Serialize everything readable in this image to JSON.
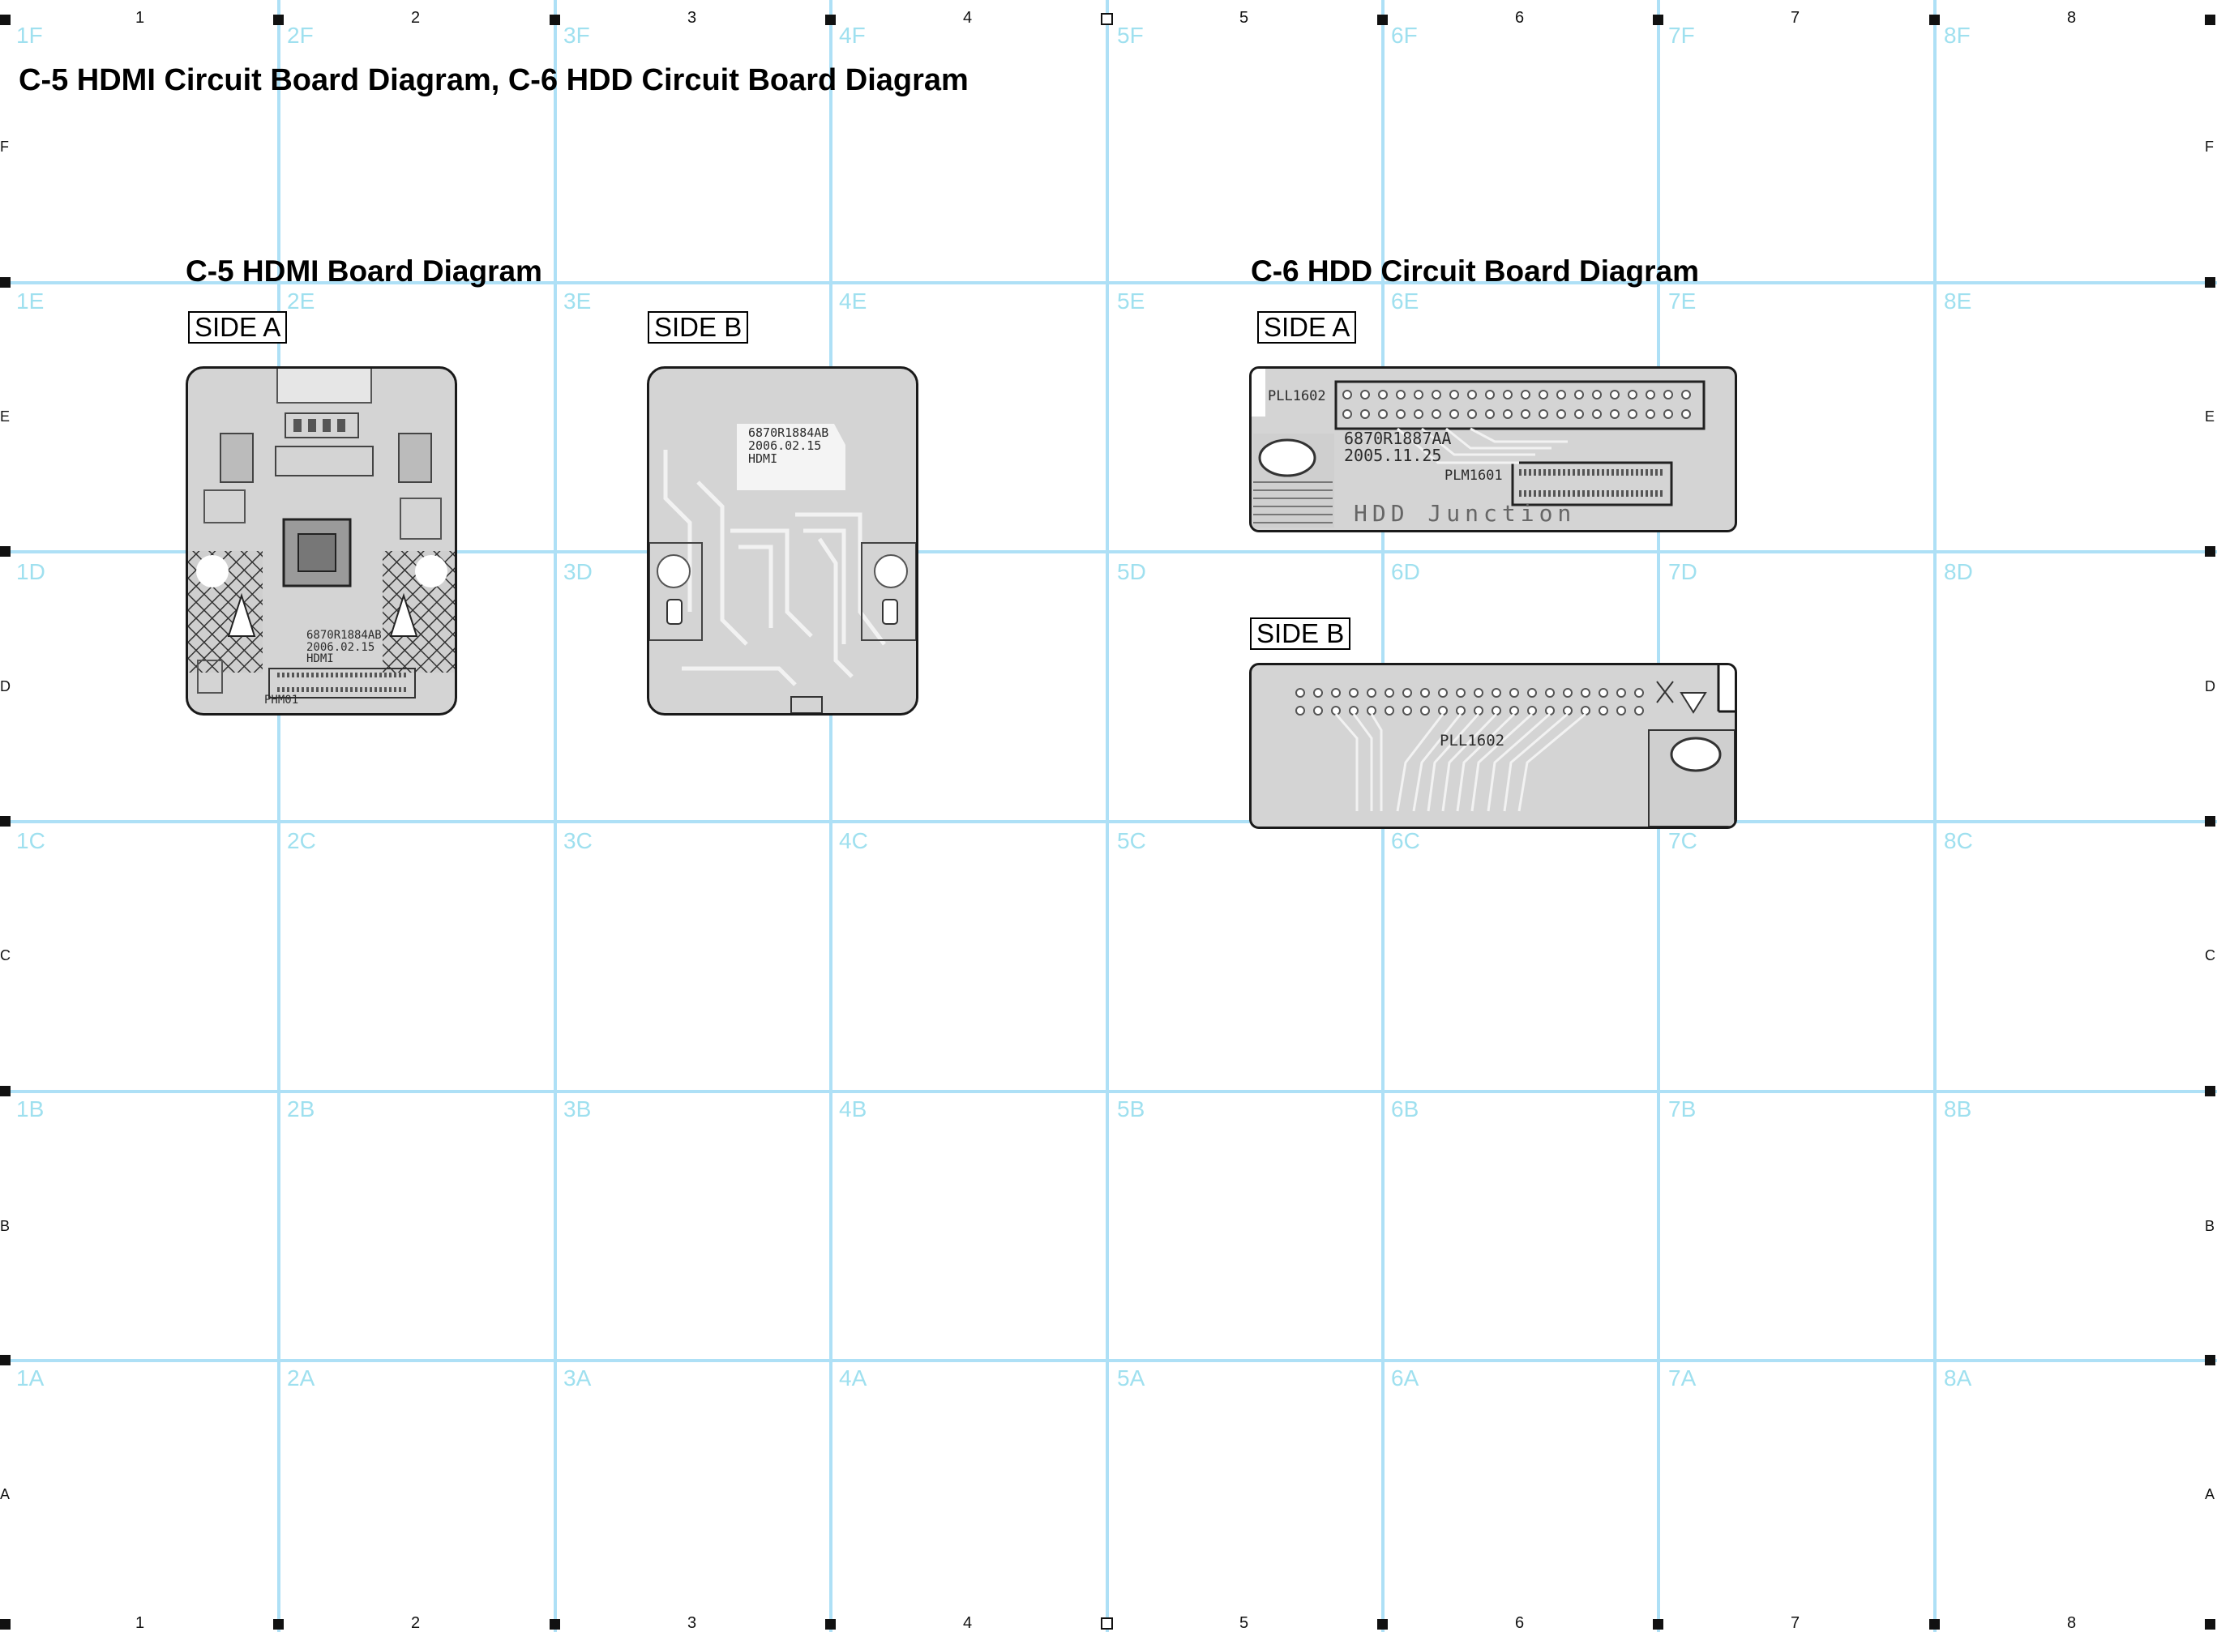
{
  "title": "C-5 HDMI Circuit Board Diagram,  C-6 HDD Circuit Board Diagram",
  "grid": {
    "columns": [
      "1",
      "2",
      "3",
      "4",
      "5",
      "6",
      "7",
      "8"
    ],
    "rows": [
      "F",
      "E",
      "D",
      "C",
      "B",
      "A"
    ],
    "cells": [
      [
        "1F",
        "2F",
        "3F",
        "4F",
        "5F",
        "6F",
        "7F",
        "8F"
      ],
      [
        "1E",
        "2E",
        "3E",
        "4E",
        "5E",
        "6E",
        "7E",
        "8E"
      ],
      [
        "1D",
        "2D",
        "3D",
        "4D",
        "5D",
        "6D",
        "7D",
        "8D"
      ],
      [
        "1C",
        "2C",
        "3C",
        "4C",
        "5C",
        "6C",
        "7C",
        "8C"
      ],
      [
        "1B",
        "2B",
        "3B",
        "4B",
        "5B",
        "6B",
        "7B",
        "8B"
      ],
      [
        "1A",
        "2A",
        "3A",
        "4A",
        "5A",
        "6A",
        "7A",
        "8A"
      ]
    ]
  },
  "hdmi": {
    "title": "C-5 HDMI Board Diagram",
    "side_a": {
      "label": "SIDE A",
      "silk_part": "6870R1884AB\n2006.02.15\nHDMI",
      "connector_ref": "PHM01"
    },
    "side_b": {
      "label": "SIDE B",
      "silk_part": "6870R1884AB\n2006.02.15\nHDMI"
    }
  },
  "hdd": {
    "title": "C-6 HDD Circuit Board Diagram",
    "side_a": {
      "label": "SIDE A",
      "ref_top": "PLL1602",
      "silk_part": "6870R1887AA\n2005.11.25",
      "ref_conn": "PLM1601",
      "silk_name": "HDD Junction"
    },
    "side_b": {
      "label": "SIDE B",
      "ref": "PLL1602"
    }
  },
  "colors": {
    "grid": "#aee0f6",
    "grid_text": "#9fe0ef",
    "board_fill": "#d4d4d4",
    "board_outline": "#1a1a1a"
  }
}
